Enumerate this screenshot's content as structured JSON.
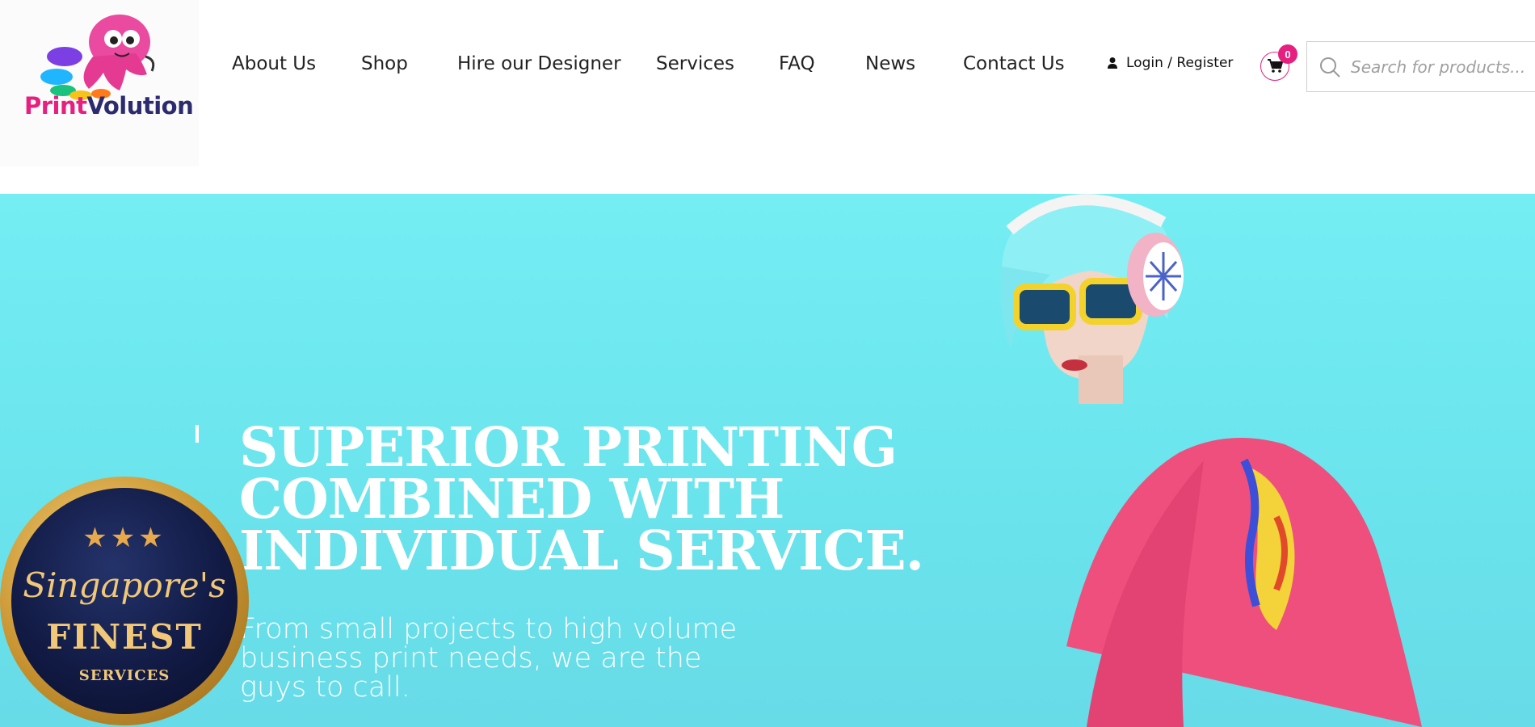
{
  "brand": {
    "name_part1": "Print",
    "name_part2": "Volution",
    "colors": {
      "pink": "#e5207f",
      "navy": "#2b2b6e",
      "hero_bg": "#6ee8f0"
    }
  },
  "nav": {
    "items": [
      {
        "label": "About Us"
      },
      {
        "label": "Shop"
      },
      {
        "label": "Hire our Designer"
      },
      {
        "label": "Services"
      },
      {
        "label": "FAQ"
      },
      {
        "label": "News"
      },
      {
        "label": "Contact Us"
      }
    ],
    "login_label": "Login / Register",
    "cart_count": "0",
    "search_placeholder": "Search for products..."
  },
  "hero": {
    "title_lines": [
      "SUPERIOR PRINTING",
      "COMBINED WITH",
      "INDIVIDUAL SERVICE."
    ],
    "subtitle_lines": [
      "From small projects to high volume",
      "business print needs, we are the",
      "guys to call."
    ]
  },
  "badge": {
    "stars": "★★★",
    "line1": "Singapore's",
    "line2": "FINEST",
    "line3": "SERVICES"
  },
  "icons": {
    "user": "user-icon",
    "cart": "cart-icon",
    "search": "search-icon"
  }
}
